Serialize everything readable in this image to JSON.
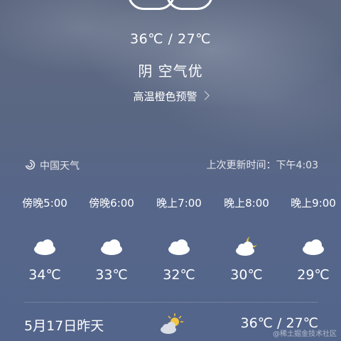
{
  "current": {
    "temp_range": "36℃ / 27℃",
    "condition": "阴  空气优",
    "alert": "高温橙色预警"
  },
  "source": {
    "name": "中国天气",
    "update": "上次更新时间：下午4:03"
  },
  "hourly": [
    {
      "time": "傍晚5:00",
      "temp": "34℃",
      "icon": "cloud-icon"
    },
    {
      "time": "傍晚6:00",
      "temp": "33℃",
      "icon": "cloud-icon"
    },
    {
      "time": "晚上7:00",
      "temp": "32℃",
      "icon": "cloud-icon"
    },
    {
      "time": "晚上8:00",
      "temp": "30℃",
      "icon": "moon-cloud-icon"
    },
    {
      "time": "晚上9:00",
      "temp": "29℃",
      "icon": "cloud-icon"
    }
  ],
  "daily": [
    {
      "date": "5月17日昨天",
      "icon": "sun-cloud-icon",
      "range": "36℃ / 27℃"
    }
  ],
  "watermark": "@稀土掘金技术社区",
  "colors": {
    "sun": "#f4c542",
    "moon": "#f1c232",
    "cloud": "#ffffff"
  }
}
